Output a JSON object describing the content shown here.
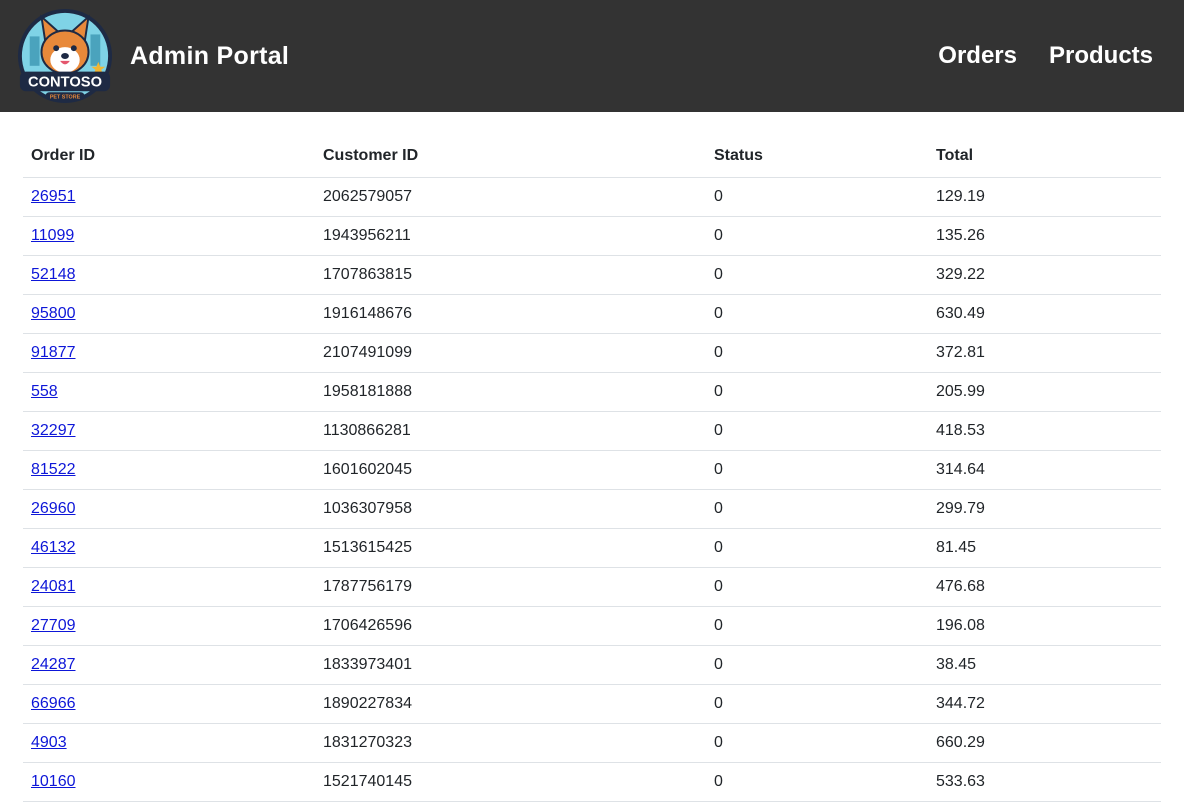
{
  "header": {
    "logo_icon": "contoso-pet-store-logo",
    "logo_text": "CONTOSO",
    "logo_subtext": "PET STORE",
    "title": "Admin Portal",
    "nav": [
      {
        "label": "Orders"
      },
      {
        "label": "Products"
      }
    ]
  },
  "table": {
    "columns": [
      "Order ID",
      "Customer ID",
      "Status",
      "Total"
    ],
    "rows": [
      {
        "order_id": "26951",
        "customer_id": "2062579057",
        "status": "0",
        "total": "129.19"
      },
      {
        "order_id": "11099",
        "customer_id": "1943956211",
        "status": "0",
        "total": "135.26"
      },
      {
        "order_id": "52148",
        "customer_id": "1707863815",
        "status": "0",
        "total": "329.22"
      },
      {
        "order_id": "95800",
        "customer_id": "1916148676",
        "status": "0",
        "total": "630.49"
      },
      {
        "order_id": "91877",
        "customer_id": "2107491099",
        "status": "0",
        "total": "372.81"
      },
      {
        "order_id": "558",
        "customer_id": "1958181888",
        "status": "0",
        "total": "205.99"
      },
      {
        "order_id": "32297",
        "customer_id": "1130866281",
        "status": "0",
        "total": "418.53"
      },
      {
        "order_id": "81522",
        "customer_id": "1601602045",
        "status": "0",
        "total": "314.64"
      },
      {
        "order_id": "26960",
        "customer_id": "1036307958",
        "status": "0",
        "total": "299.79"
      },
      {
        "order_id": "46132",
        "customer_id": "1513615425",
        "status": "0",
        "total": "81.45"
      },
      {
        "order_id": "24081",
        "customer_id": "1787756179",
        "status": "0",
        "total": "476.68"
      },
      {
        "order_id": "27709",
        "customer_id": "1706426596",
        "status": "0",
        "total": "196.08"
      },
      {
        "order_id": "24287",
        "customer_id": "1833973401",
        "status": "0",
        "total": "38.45"
      },
      {
        "order_id": "66966",
        "customer_id": "1890227834",
        "status": "0",
        "total": "344.72"
      },
      {
        "order_id": "4903",
        "customer_id": "1831270323",
        "status": "0",
        "total": "660.29"
      },
      {
        "order_id": "10160",
        "customer_id": "1521740145",
        "status": "0",
        "total": "533.63"
      }
    ]
  },
  "colors": {
    "header_bg": "#333333",
    "link": "#0d16d8",
    "border": "#dee2e6"
  }
}
